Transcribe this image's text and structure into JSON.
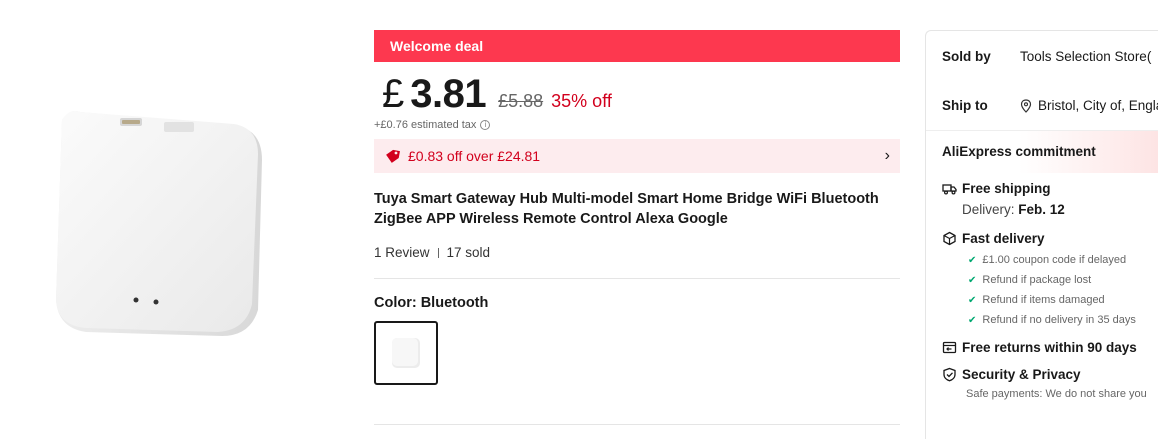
{
  "product": {
    "deal_banner": "Welcome deal",
    "currency_symbol": "£",
    "price": "3.81",
    "old_price": "£5.88",
    "discount": "35% off",
    "tax_note": "+£0.76 estimated tax",
    "coupon_text": "£0.83 off over £24.81",
    "title": "Tuya Smart Gateway Hub Multi-model Smart Home Bridge WiFi Bluetooth ZigBee APP Wireless Remote Control Alexa Google",
    "reviews": "1 Review",
    "sold": "17 sold",
    "color_label": "Color: Bluetooth"
  },
  "seller": {
    "sold_by_label": "Sold by",
    "sold_by_value": "Tools Selection Store(",
    "ship_to_label": "Ship to",
    "ship_to_value": "Bristol, City of, Englan"
  },
  "commitment": {
    "title": "AliExpress commitment",
    "free_shipping": "Free shipping",
    "delivery_label": "Delivery:",
    "delivery_date": "Feb. 12",
    "fast_delivery": "Fast delivery",
    "guarantees": [
      "£1.00 coupon code if delayed",
      "Refund if package lost",
      "Refund if items damaged",
      "Refund if no delivery in 35 days"
    ],
    "free_returns": "Free returns within 90 days",
    "security": "Security & Privacy",
    "security_note": "Safe payments: We do not share you"
  },
  "colors": {
    "accent": "#fd384f",
    "price_red": "#d2001d",
    "check_green": "#00a870"
  },
  "icons": [
    "tag-icon",
    "chevron-right-icon",
    "info-icon",
    "location-pin-icon",
    "truck-icon",
    "box-icon",
    "check-icon",
    "return-icon",
    "shield-icon"
  ]
}
